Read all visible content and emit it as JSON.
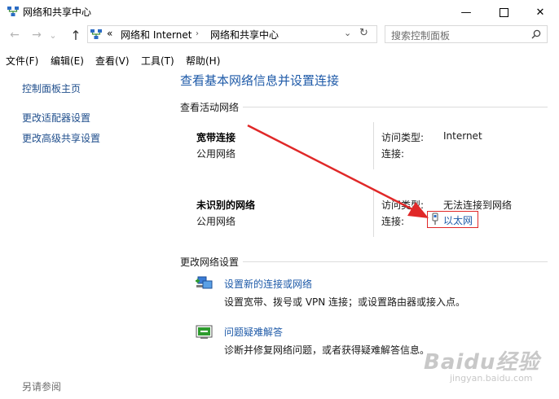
{
  "window": {
    "title": "网络和共享中心",
    "minimize_glyph": "—",
    "maximize_glyph": "☐",
    "close_glyph": "✕"
  },
  "nav": {
    "back_glyph": "←",
    "forward_glyph": "→",
    "dropdown_glyph": "⌄",
    "up_glyph": "↑",
    "breadcrumb_prefix": "«",
    "breadcrumbs": [
      "网络和 Internet",
      "网络和共享中心"
    ],
    "addr_dropdown_glyph": "⌄",
    "refresh_glyph": "↻",
    "search_placeholder": "搜索控制面板",
    "search_glyph": "⚲"
  },
  "menu": [
    "文件(F)",
    "编辑(E)",
    "查看(V)",
    "工具(T)",
    "帮助(H)"
  ],
  "sidebar": {
    "items": [
      "控制面板主页",
      "更改适配器设置",
      "更改高级共享设置"
    ],
    "see_also": "另请参阅"
  },
  "main": {
    "title": "查看基本网络信息并设置连接",
    "active_section": "查看活动网络",
    "networks": [
      {
        "name": "宽带连接",
        "category": "公用网络",
        "access_label": "访问类型:",
        "access_value": "Internet",
        "conn_label": "连接:",
        "conn_value": ""
      },
      {
        "name": "未识别的网络",
        "category": "公用网络",
        "access_label": "访问类型:",
        "access_value": "无法连接到网络",
        "conn_label": "连接:",
        "conn_value": "以太网"
      }
    ],
    "change_section": "更改网络设置",
    "tasks": [
      {
        "icon": "new-connection-icon",
        "link": "设置新的连接或网络",
        "desc": "设置宽带、拨号或 VPN 连接；或设置路由器或接入点。"
      },
      {
        "icon": "troubleshoot-icon",
        "link": "问题疑难解答",
        "desc": "诊断并修复网络问题，或者获得疑难解答信息。"
      }
    ]
  },
  "watermark": {
    "brand": "Baidu经验",
    "url": "jingyan.baidu.com"
  },
  "colors": {
    "link": "#1e5aa8",
    "annotation": "#e02828"
  }
}
